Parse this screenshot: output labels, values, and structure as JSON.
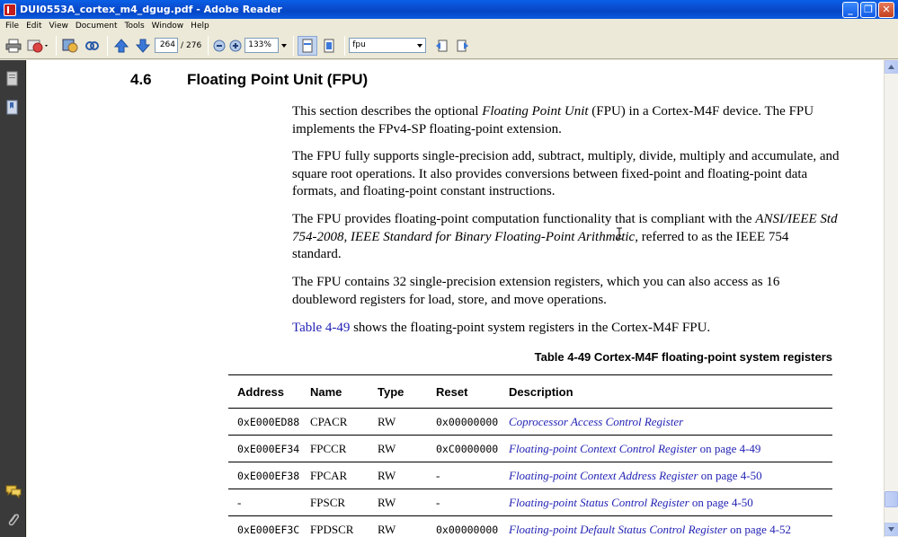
{
  "window": {
    "title": "DUI0553A_cortex_m4_dgug.pdf - Adobe Reader",
    "buttons": {
      "minimize": "_",
      "maximize": "❐",
      "close": "✕"
    }
  },
  "menu": [
    "File",
    "Edit",
    "View",
    "Document",
    "Tools",
    "Window",
    "Help"
  ],
  "toolbar": {
    "page_current": "264",
    "page_sep": "/",
    "page_total": "276",
    "zoom": "133%",
    "find_value": "fpu"
  },
  "doc": {
    "section_number": "4.6",
    "section_title": "Floating Point Unit (FPU)",
    "p1_a": "This section describes the optional ",
    "p1_italic": "Floating Point Unit",
    "p1_b": " (FPU) in a Cortex-M4F device. The FPU implements the FPv4-SP floating-point extension.",
    "p2": "The FPU fully supports single-precision add, subtract, multiply, divide, multiply and accumulate, and square root operations. It also provides conversions between fixed-point and floating-point data formats, and floating-point constant instructions.",
    "p3_a": "The FPU provides floating-point computation functionality that is compliant with the ",
    "p3_italic": "ANSI/IEEE Std 754-2008, IEEE Standard for Binary Floating-Point Arithmetic",
    "p3_b": ", referred to as the IEEE 754 standard.",
    "p4": "The FPU contains 32 single-precision extension registers, which you can also access as 16 doubleword registers for load, store, and move operations.",
    "p5_link": "Table 4-49",
    "p5_rest": " shows the floating-point system registers in the Cortex-M4F FPU.",
    "table_caption": "Table 4-49 Cortex-M4F floating-point system registers",
    "table_headers": [
      "Address",
      "Name",
      "Type",
      "Reset",
      "Description"
    ],
    "table_rows": [
      {
        "address": "0xE000ED88",
        "name": "CPACR",
        "type": "RW",
        "reset": "0x00000000",
        "desc_link": "Coprocessor Access Control Register",
        "desc_page": ""
      },
      {
        "address": "0xE000EF34",
        "name": "FPCCR",
        "type": "RW",
        "reset": "0xC0000000",
        "desc_link": "Floating-point Context Control Register",
        "desc_page": " on page 4-49"
      },
      {
        "address": "0xE000EF38",
        "name": "FPCAR",
        "type": "RW",
        "reset": "-",
        "desc_link": "Floating-point Context Address Register",
        "desc_page": " on page 4-50"
      },
      {
        "address": "-",
        "name": "FPSCR",
        "type": "RW",
        "reset": "-",
        "desc_link": "Floating-point Status Control Register",
        "desc_page": " on page 4-50"
      },
      {
        "address": "0xE000EF3C",
        "name": "FPDSCR",
        "type": "RW",
        "reset": "0x00000000",
        "desc_link": "Floating-point Default Status Control Register",
        "desc_page": " on page 4-52"
      }
    ]
  },
  "colors": {
    "link": "#2323b5",
    "titlebar": "#0a4dd0",
    "left_panel": "#3a3a3a"
  }
}
